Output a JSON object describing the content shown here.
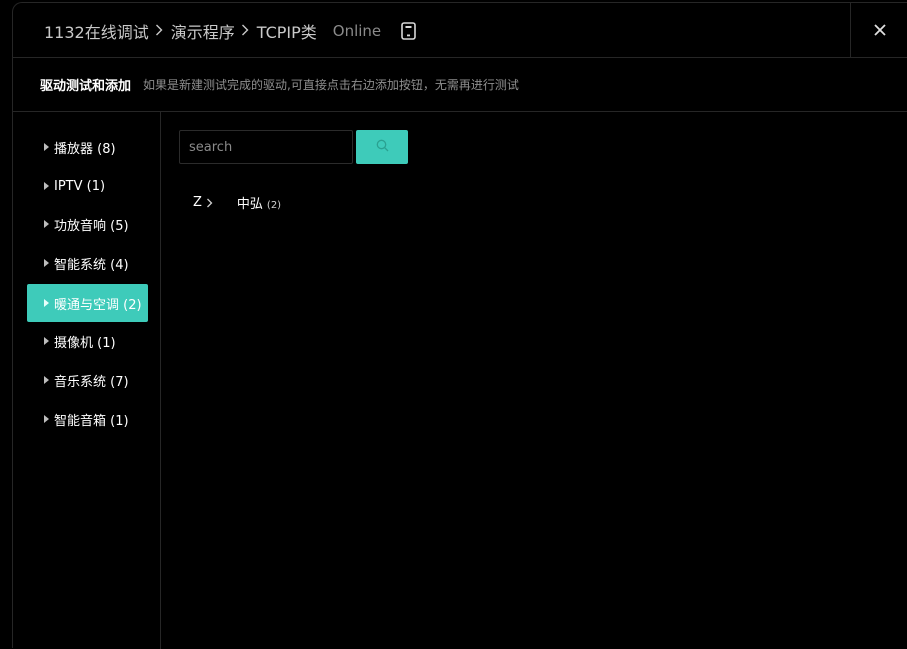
{
  "breadcrumb": {
    "items": [
      "1132在线调试",
      "演示程序",
      "TCPIP类"
    ],
    "status": "Online"
  },
  "subheader": {
    "title": "驱动测试和添加",
    "hint": "如果是新建测试完成的驱动,可直接点击右边添加按钮，无需再进行测试"
  },
  "sidebar": {
    "items": [
      {
        "label": "播放器 (8)",
        "active": false
      },
      {
        "label": "IPTV (1)",
        "active": false
      },
      {
        "label": "功放音响 (5)",
        "active": false
      },
      {
        "label": "智能系统 (4)",
        "active": false
      },
      {
        "label": "暖通与空调 (2)",
        "active": true
      },
      {
        "label": "摄像机 (1)",
        "active": false
      },
      {
        "label": "音乐系统 (7)",
        "active": false
      },
      {
        "label": "智能音箱 (1)",
        "active": false
      }
    ]
  },
  "search": {
    "placeholder": "search",
    "value": ""
  },
  "brands": {
    "letter": "Z",
    "items": [
      {
        "name": "中弘",
        "count": "(2)"
      }
    ]
  },
  "icons": {
    "close": "close-icon",
    "device": "tablet-icon",
    "search": "search-icon",
    "chevron": "chevron-right-icon"
  },
  "colors": {
    "accent": "#3ecbba",
    "background": "#000000",
    "border": "#262626"
  }
}
